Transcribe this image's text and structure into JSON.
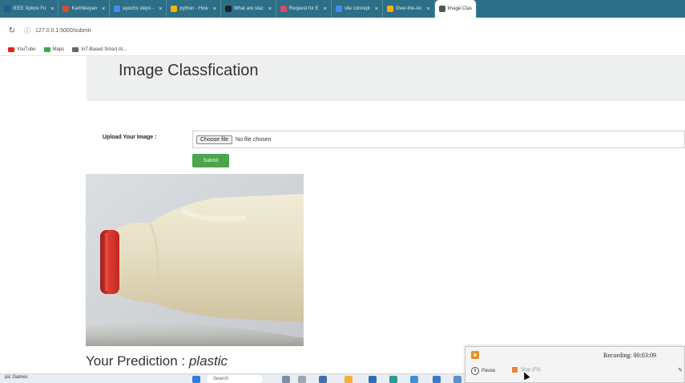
{
  "browser": {
    "tabs": [
      {
        "label": "IEEE Xplore Fu",
        "color": "#1f5c8f"
      },
      {
        "label": "Karthikeyan",
        "color": "#d94b3b"
      },
      {
        "label": "epochs steps -",
        "color": "#4a8af4"
      },
      {
        "label": "python - How",
        "color": "#f4b400"
      },
      {
        "label": "What are stac",
        "color": "#202124"
      },
      {
        "label": "Request for E",
        "color": "#d64a6b"
      },
      {
        "label": "site concept",
        "color": "#4a8af4"
      },
      {
        "label": "Over-the-Air",
        "color": "#f4b400"
      },
      {
        "label": "Image Clas",
        "color": "#555555"
      }
    ],
    "url": "127.0.0.1:5000/submit",
    "bookmarks": [
      {
        "label": "YouTube",
        "color": "#e62117"
      },
      {
        "label": "Maps",
        "color": "#34a853"
      },
      {
        "label": "IoT-Based Smart Al...",
        "color": "#666666"
      }
    ]
  },
  "page": {
    "title": "Image Classfication",
    "upload_label": "Upload Your Image :",
    "choose_file": "Choose file",
    "no_file": "No file chosen",
    "submit": "Submit",
    "prediction_label": "Your Prediction : ",
    "prediction_value": "plastic"
  },
  "taskbar": {
    "left_label": "pic Games",
    "search": "Search"
  },
  "recorder": {
    "status": "Recording:  00:03:09",
    "pause": "Pause",
    "stop": "Stop (F8)"
  }
}
